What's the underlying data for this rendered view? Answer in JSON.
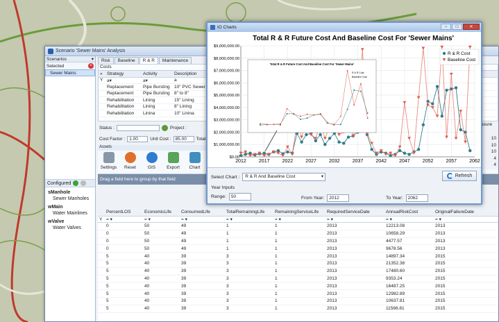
{
  "window": {
    "title": "Scenario 'Sewer Mains' Analysis"
  },
  "left": {
    "scenarios_label": "Scenarios",
    "selected_label": "Selected",
    "selected_item": "Sewer Mains",
    "configured_label": "Configured",
    "configured_items": [
      {
        "name": "sManhole",
        "sub": "Sewer Manholes"
      },
      {
        "name": "wMain",
        "sub": "Water Mainlines"
      },
      {
        "name": "wValve",
        "sub": "Water Valves"
      }
    ]
  },
  "tabs": [
    "Risk",
    "Baseline",
    "R & R",
    "Maintenance"
  ],
  "costs": {
    "label": "Costs",
    "headers": [
      "Strategy",
      "Activity",
      "Description"
    ],
    "rows": [
      [
        "Replacement",
        "Pipe Bursting",
        "10\" PVC Sewer Ma"
      ],
      [
        "Replacement",
        "Pipe Bursting",
        "8\" to 8\""
      ],
      [
        "Rehabilitation",
        "Lining",
        "15\"  Lining"
      ],
      [
        "Rehabilitation",
        "Lining",
        "8\"  Lining"
      ],
      [
        "Rehabilitation",
        "Linina",
        "10\"  Linina"
      ]
    ]
  },
  "status": {
    "status_label": "Status :",
    "project_label": "Project :",
    "range_label": "Range:"
  },
  "factors": {
    "cost_factor_label": "Cost Factor :",
    "cost_factor": "1.00",
    "unit_cost_label": "Unit Cost :",
    "unit_cost": "85.00",
    "total_label": "Total Co"
  },
  "assets_label": "Assets",
  "ribbon": [
    "Settings",
    "Reset",
    "GIS",
    "Export",
    "Chart"
  ],
  "groupbar": "Drag a field here to group by that field",
  "right_measure": {
    "label": "Measure",
    "values": [
      "10",
      "10",
      "10",
      "4",
      "4"
    ]
  },
  "assets": {
    "headers": [
      "PercentLOS",
      "EconomicLife",
      "ConsumedLife",
      "TotalRemainingLife",
      "RemainingServiceLife",
      "RequiredServiceDate",
      "AnnualRiskCost",
      "OriginalFailureDate"
    ],
    "rows": [
      [
        "0",
        "50",
        "49",
        "1",
        "1",
        "2013",
        "12213.08",
        "2013"
      ],
      [
        "0",
        "50",
        "49",
        "1",
        "1",
        "2013",
        "10658.29",
        "2013"
      ],
      [
        "0",
        "50",
        "49",
        "1",
        "1",
        "2013",
        "4477.57",
        "2013"
      ],
      [
        "0",
        "50",
        "49",
        "1",
        "1",
        "2013",
        "9678.56",
        "2013"
      ],
      [
        "5",
        "40",
        "39",
        "3",
        "1",
        "2013",
        "14897.34",
        "2015"
      ],
      [
        "5",
        "40",
        "39",
        "3",
        "1",
        "2013",
        "21352.38",
        "2015"
      ],
      [
        "5",
        "40",
        "39",
        "3",
        "1",
        "2013",
        "17480.60",
        "2015"
      ],
      [
        "5",
        "40",
        "39",
        "3",
        "1",
        "2013",
        "9353.24",
        "2015"
      ],
      [
        "5",
        "40",
        "39",
        "3",
        "1",
        "2013",
        "16487.25",
        "2015"
      ],
      [
        "5",
        "40",
        "39",
        "3",
        "1",
        "2013",
        "12982.89",
        "2015"
      ],
      [
        "5",
        "40",
        "39",
        "3",
        "1",
        "2013",
        "10637.81",
        "2015"
      ],
      [
        "5",
        "40",
        "39",
        "3",
        "1",
        "2013",
        "11566.81",
        "2015"
      ]
    ]
  },
  "dialog": {
    "title": "IO Charts",
    "select_chart_label": "Select Chart :",
    "select_chart_value": "R & R And Baseline Cost",
    "refresh_label": "Refresh",
    "year_inputs_label": "Year Inputs",
    "range_label": "Range:",
    "range_value": "50",
    "from_year_label": "From Year:",
    "from_year": "2012",
    "to_year_label": "To Year:",
    "to_year": "2062"
  },
  "chart_data": {
    "type": "line",
    "title": "Total R & R Future Cost And Baseline Cost For 'Sewer Mains'",
    "xlim": [
      2012,
      2062
    ],
    "ylim": [
      0,
      9000000
    ],
    "xticks": [
      2012,
      2017,
      2022,
      2027,
      2032,
      2037,
      2042,
      2047,
      2052,
      2057,
      2062
    ],
    "yticks": [
      "$0.00",
      "$1,000,000.00",
      "$2,000,000.00",
      "$3,000,000.00",
      "$4,000,000.00",
      "$5,000,000.00",
      "$6,000,000.00",
      "$7,000,000.00",
      "$8,000,000.00",
      "$9,000,000.00"
    ],
    "legend_position": "top-right",
    "series": [
      {
        "name": "R & R Cost",
        "color": "#2f7d8a",
        "x": [
          2012,
          2013,
          2014,
          2015,
          2016,
          2017,
          2018,
          2019,
          2020,
          2021,
          2022,
          2023,
          2024,
          2025,
          2026,
          2027,
          2028,
          2029,
          2030,
          2031,
          2032,
          2033,
          2034,
          2035,
          2036,
          2037,
          2038,
          2039,
          2040,
          2041,
          2042,
          2043,
          2044,
          2045,
          2046,
          2047,
          2048,
          2049,
          2050,
          2051,
          2052,
          2053,
          2054,
          2055,
          2056,
          2057,
          2058,
          2059,
          2060,
          2061
        ],
        "values": [
          100000,
          200000,
          300000,
          150000,
          250000,
          300000,
          200000,
          400000,
          500000,
          250000,
          400000,
          300000,
          1900000,
          1200000,
          1800000,
          1900000,
          1300000,
          1800000,
          1000000,
          1500000,
          1900000,
          1200000,
          1100000,
          1600000,
          1700000,
          2000000,
          2500000,
          1800000,
          600000,
          200000,
          400000,
          300000,
          100000,
          200000,
          500000,
          300000,
          200000,
          400000,
          600000,
          2600000,
          4500000,
          4300000,
          5700000,
          3300000,
          5400000,
          5500000,
          5600000,
          2200000,
          2000000,
          500000
        ]
      },
      {
        "name": "Baseline Cost",
        "color": "#e05a4a",
        "x": [
          2012,
          2013,
          2014,
          2015,
          2016,
          2017,
          2018,
          2019,
          2020,
          2021,
          2022,
          2023,
          2024,
          2025,
          2026,
          2027,
          2028,
          2029,
          2030,
          2031,
          2032,
          2033,
          2034,
          2035,
          2036,
          2037,
          2038,
          2039,
          2040,
          2041,
          2042,
          2043,
          2044,
          2045,
          2046,
          2047,
          2048,
          2049,
          2050,
          2051,
          2052,
          2053,
          2054,
          2055,
          2056,
          2057,
          2058,
          2059,
          2060,
          2061
        ],
        "values": [
          300000,
          400000,
          100000,
          200000,
          300000,
          100000,
          200000,
          400000,
          300000,
          100000,
          800000,
          200000,
          2700000,
          1600000,
          2900000,
          1800000,
          1500000,
          2700000,
          1500000,
          2500000,
          3600000,
          1800000,
          2000000,
          3000000,
          1700000,
          2600000,
          8700000,
          1900000,
          1100000,
          300000,
          500000,
          200000,
          300000,
          100000,
          800000,
          4400000,
          1500000,
          300000,
          4800000,
          8800000,
          4200000,
          4000000,
          3300000,
          8900000,
          1600000,
          6700000,
          1500000,
          3700000,
          1200000,
          8900000
        ]
      }
    ]
  },
  "inset": {
    "title": "Total R & R Future Cost And Baseline Cost For 'Sewer Mains'",
    "legend": [
      "R & R Cost",
      "Baseline Cost"
    ]
  }
}
